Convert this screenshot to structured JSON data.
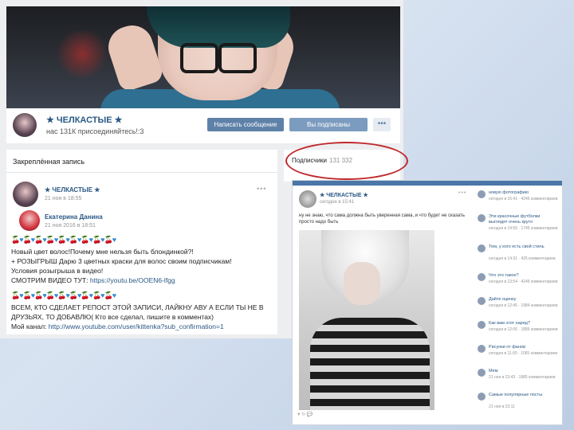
{
  "group": {
    "name": "★ ЧЕЛКАСТЫЕ ★",
    "subtitle": "нас 131К присоединяйтесь!:3",
    "buttons": {
      "message": "Написать сообщение",
      "subscribed": "Вы подписаны",
      "more": "•••"
    }
  },
  "wall": {
    "pinned_label": "Закреплённая запись",
    "post": {
      "author": "★ ЧЕЛКАСТЫЕ ★",
      "date": "21 ноя в 18:55",
      "repost_author": "Екатерина Данина",
      "repost_date": "21 ноя 2016 в 18:51",
      "line1": "Новый цвет волос!Почему мне нельзя быть блондинкой?!",
      "line2": "+ РОЗЫГРЫШ Дарю 3 цветных краски для волос своим подписчикам!",
      "line3": "Условия розыгрыша в видео!",
      "line4_label": "СМОТРИМ ВИДЕО ТУТ:",
      "line4_link": "https://youtu.be/OOEN6-lfgg",
      "line5": "ВСЕМ, КТО СДЕЛАЕТ РЕПОСТ ЭТОЙ ЗАПИСИ, ЛАЙКНУ АВУ А ЕСЛИ ТЫ НЕ В",
      "line6": "ДРУЗЬЯХ, ТО ДОБАВЛЮ( Кто все сделал, пишите в комментах)",
      "line7_label": "Мой канал:",
      "line7_link": "http://www.youtube.com/user/kittenka?sub_confirmation=1"
    }
  },
  "subscribers": {
    "label": "Подписчики",
    "count": "131 332"
  },
  "screenshot2": {
    "author": "★ ЧЕЛКАСТЫЕ ★",
    "date": "сегодня в 15:41",
    "text": "ну не знаю, что сама должна быть уверенная сама, и что будет не сказать просто надо быть",
    "feed": [
      {
        "title": "новую фотографию",
        "meta": "сегодня в 15:41 · 4245 комментариев"
      },
      {
        "title": "Эти красочные футболки выглядят очень круто",
        "meta": "сегодня в 14:56 · 1745 комментариев"
      },
      {
        "title": "Тем, у кого есть свой стиль",
        "meta": "сегодня в 14:31 · 425 комментариев"
      },
      {
        "title": "Что это такое?",
        "meta": "сегодня в 13:54 · 4245 комментариев"
      },
      {
        "title": "Дайте оценку",
        "meta": "сегодня в 12:45 · 1984 комментариев"
      },
      {
        "title": "Как вам этот наряд?",
        "meta": "сегодня в 12:06 · 1885 комментариев"
      },
      {
        "title": "Рисунки от фанов",
        "meta": "сегодня в 11:00 · 1065 комментариев"
      },
      {
        "title": "Мем",
        "meta": "21 ноя в 23:43 · 1985 комментариев"
      },
      {
        "title": "Самые популярные посты",
        "meta": "21 ноя в 23:11"
      }
    ]
  },
  "colors": {
    "vk_blue": "#5e81a8",
    "link": "#2a5885",
    "highlight_oval": "#c0282b"
  }
}
